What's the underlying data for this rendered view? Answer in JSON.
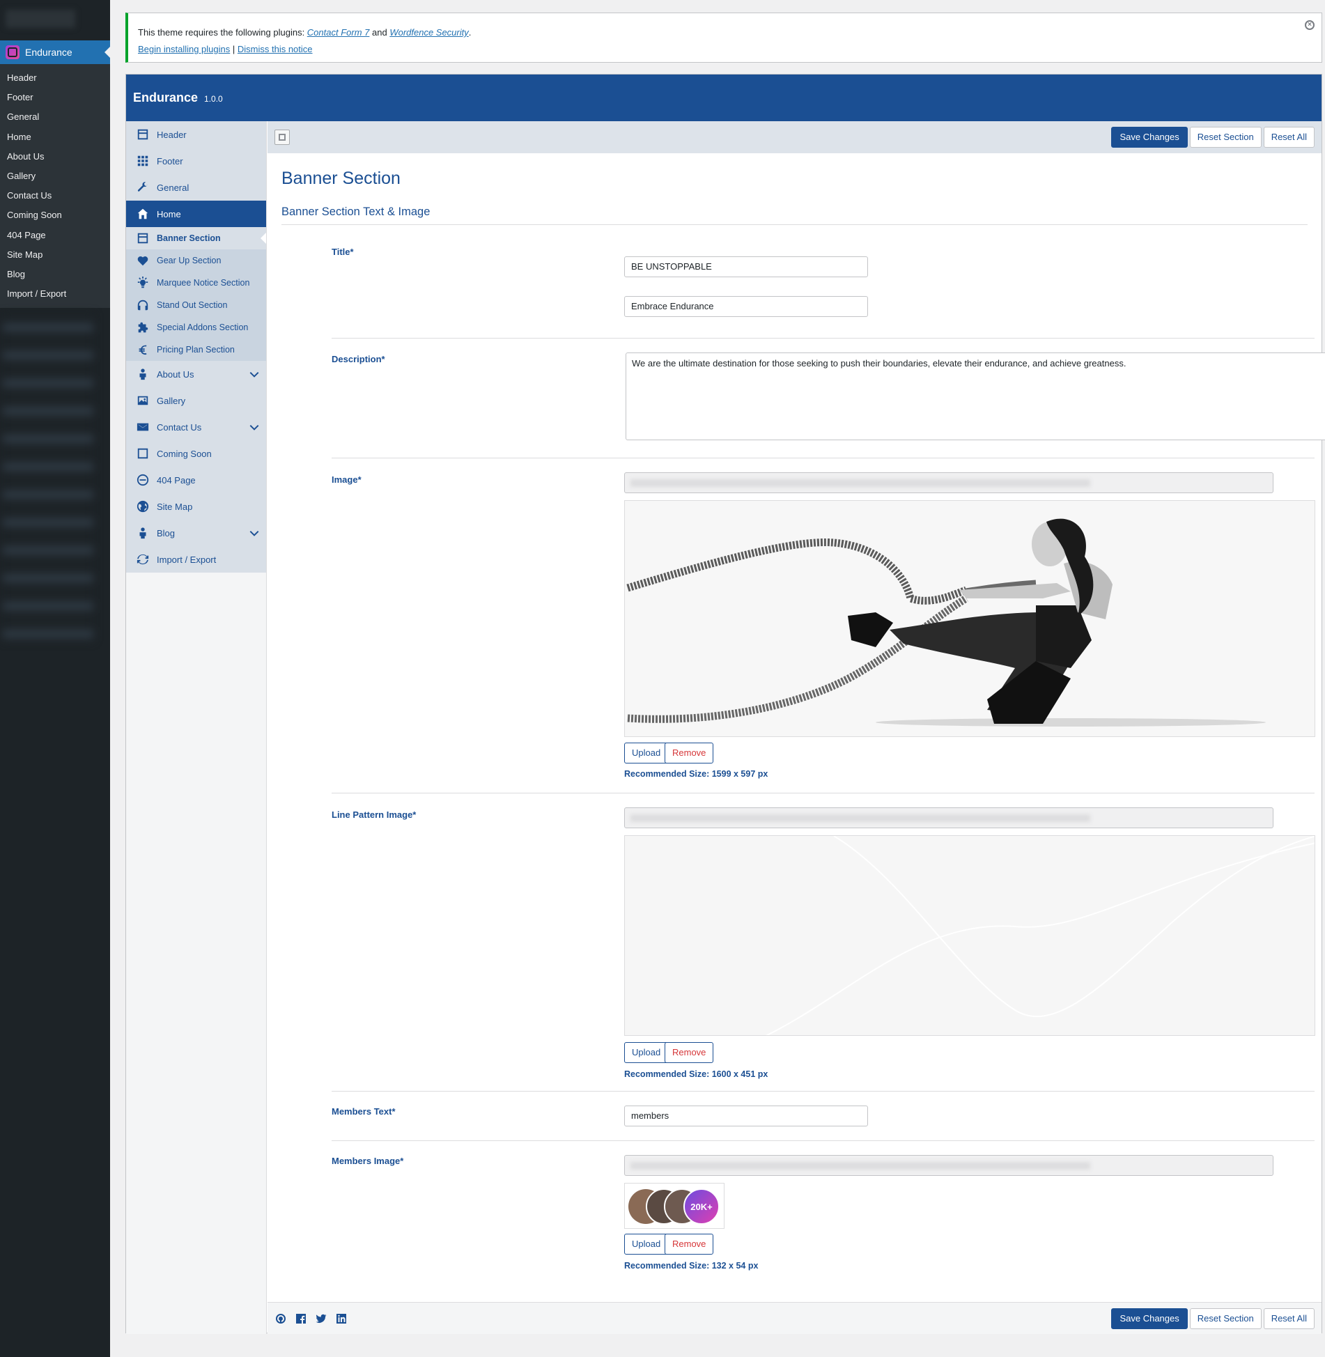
{
  "wp_menu": {
    "active_plugin": "Endurance",
    "items": [
      "Header",
      "Footer",
      "General",
      "Home",
      "About Us",
      "Gallery",
      "Contact Us",
      "Coming Soon",
      "404 Page",
      "Site Map",
      "Blog",
      "Import / Export"
    ]
  },
  "notice": {
    "text_before": "This theme requires the following plugins: ",
    "plugin1": "Contact Form 7",
    "and": " and ",
    "plugin2": "Wordfence Security",
    "period": ".",
    "begin_link": "Begin installing plugins",
    "sep": " | ",
    "dismiss_link": "Dismiss this notice",
    "close_icon": "×"
  },
  "panel": {
    "title": "Endurance",
    "version": "1.0.0"
  },
  "sidebar": {
    "items": [
      {
        "label": "Header",
        "icon": "layout-icon"
      },
      {
        "label": "Footer",
        "icon": "grid-icon"
      },
      {
        "label": "General",
        "icon": "wrench-icon"
      },
      {
        "label": "Home",
        "icon": "home-icon"
      },
      {
        "label": "About Us",
        "icon": "person-icon"
      },
      {
        "label": "Gallery",
        "icon": "image-icon"
      },
      {
        "label": "Contact Us",
        "icon": "envelope-icon"
      },
      {
        "label": "Coming Soon",
        "icon": "square-icon"
      },
      {
        "label": "404 Page",
        "icon": "minus-circle-icon"
      },
      {
        "label": "Site Map",
        "icon": "globe-icon"
      },
      {
        "label": "Blog",
        "icon": "person-icon"
      },
      {
        "label": "Import / Export",
        "icon": "refresh-icon"
      }
    ],
    "home_sub": [
      {
        "label": "Banner Section",
        "icon": "layout-icon"
      },
      {
        "label": "Gear Up Section",
        "icon": "heart-icon"
      },
      {
        "label": "Marquee Notice Section",
        "icon": "lightbulb-icon"
      },
      {
        "label": "Stand Out Section",
        "icon": "headphones-icon"
      },
      {
        "label": "Special Addons Section",
        "icon": "puzzle-icon"
      },
      {
        "label": "Pricing Plan Section",
        "icon": "euro-icon"
      }
    ]
  },
  "toolbar": {
    "save": "Save Changes",
    "reset_section": "Reset Section",
    "reset_all": "Reset All"
  },
  "main": {
    "heading": "Banner Section",
    "subheading": "Banner Section Text & Image",
    "title_label": "Title*",
    "title_value1": "BE UNSTOPPABLE",
    "title_value2": "Embrace Endurance",
    "description_label": "Description*",
    "description_value": "We are the ultimate destination for those seeking to push their boundaries, elevate their endurance, and achieve greatness.",
    "image_label": "Image*",
    "image_rec": "Recommended Size: 1599 x 597 px",
    "line_label": "Line Pattern Image*",
    "line_rec": "Recommended Size: 1600 x 451 px",
    "members_text_label": "Members Text*",
    "members_text_value": "members",
    "members_image_label": "Members Image*",
    "members_badge": "20K+",
    "members_rec": "Recommended Size: 132 x 54 px",
    "upload": "Upload",
    "remove": "Remove"
  },
  "colors": {
    "brand": "#1b4f93",
    "wp_dark": "#1d2327",
    "wp_blue": "#2271b1",
    "notice_green": "#00a32a",
    "remove_red": "#d63638"
  }
}
